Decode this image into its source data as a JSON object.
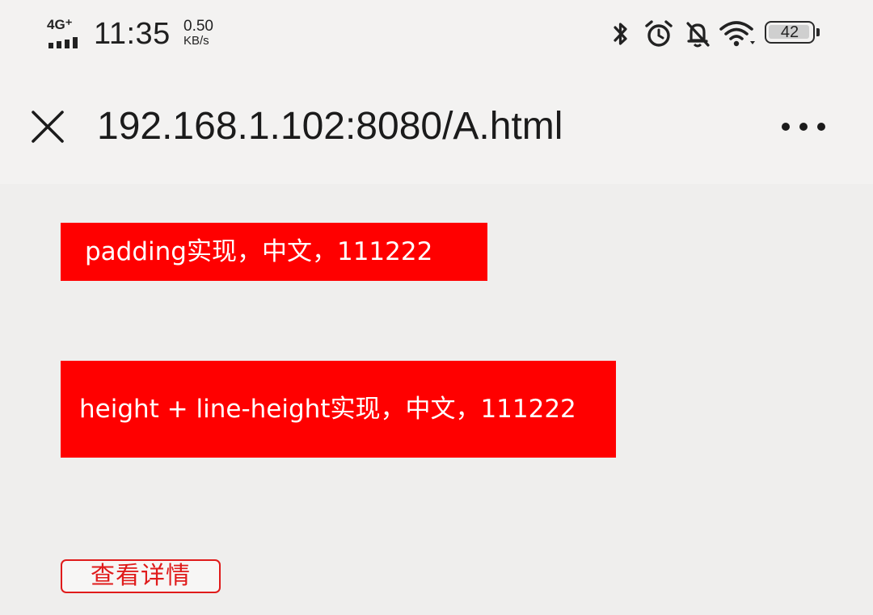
{
  "status_bar": {
    "network_type": "4G⁺",
    "time": "11:35",
    "speed_value": "0.50",
    "speed_unit": "KB/s",
    "battery_level": "42",
    "icons": [
      "signal-bars-icon",
      "bluetooth-icon",
      "alarm-icon",
      "notifications-off-icon",
      "wifi-icon",
      "battery-icon"
    ]
  },
  "title_bar": {
    "url": "192.168.1.102:8080/A.html",
    "close_icon": "close-icon",
    "more_icon": "more-dots-icon"
  },
  "content": {
    "padding_demo_text": "padding实现，中文，111222",
    "lineheight_demo_text": "height + line-height实现，中文，111222",
    "detail_button_label": "查看详情"
  },
  "colors": {
    "demo_background": "#ff0000",
    "demo_text": "#ffffff",
    "button_border": "#e01b1b",
    "page_background": "#efeeed"
  }
}
